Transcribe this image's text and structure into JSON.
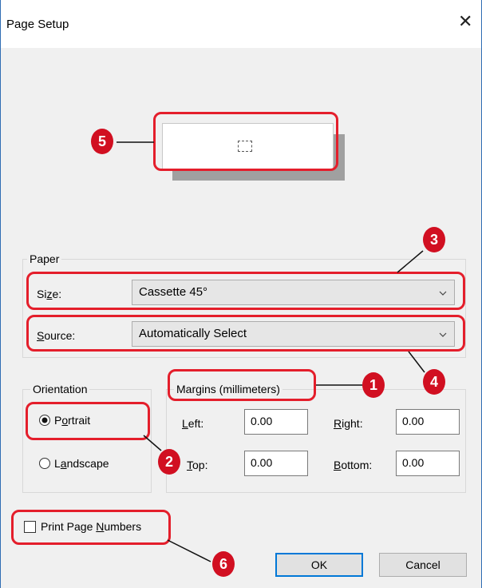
{
  "dialog": {
    "title": "Page Setup",
    "close_symbol": "✕"
  },
  "paper": {
    "group_label": "Paper",
    "size_label_pre": "Si",
    "size_label_ul": "z",
    "size_label_post": "e:",
    "size_value": "Cassette 45°",
    "source_label_pre": "",
    "source_label_ul": "S",
    "source_label_post": "ource:",
    "source_value": "Automatically Select"
  },
  "orientation": {
    "group_label": "Orientation",
    "portrait_pre": "P",
    "portrait_ul": "o",
    "portrait_post": "rtrait",
    "landscape_pre": "L",
    "landscape_ul": "a",
    "landscape_post": "ndscape",
    "selected": "Portrait"
  },
  "margins": {
    "group_label": "Margins (millimeters)",
    "left_ul": "L",
    "left_post": "eft:",
    "left_value": "0.00",
    "right_ul": "R",
    "right_post": "ight:",
    "right_value": "0.00",
    "top_ul": "T",
    "top_post": "op:",
    "top_value": "0.00",
    "bottom_ul": "B",
    "bottom_post": "ottom:",
    "bottom_value": "0.00"
  },
  "options": {
    "print_page_numbers_pre": "Print Page ",
    "print_page_numbers_ul": "N",
    "print_page_numbers_post": "umbers",
    "print_page_numbers_checked": false
  },
  "buttons": {
    "ok": "OK",
    "cancel": "Cancel"
  },
  "callouts": [
    "1",
    "2",
    "3",
    "4",
    "5",
    "6"
  ],
  "colors": {
    "callout": "#d10f21",
    "highlight": "#e41e2b",
    "accent": "#0078d7"
  }
}
